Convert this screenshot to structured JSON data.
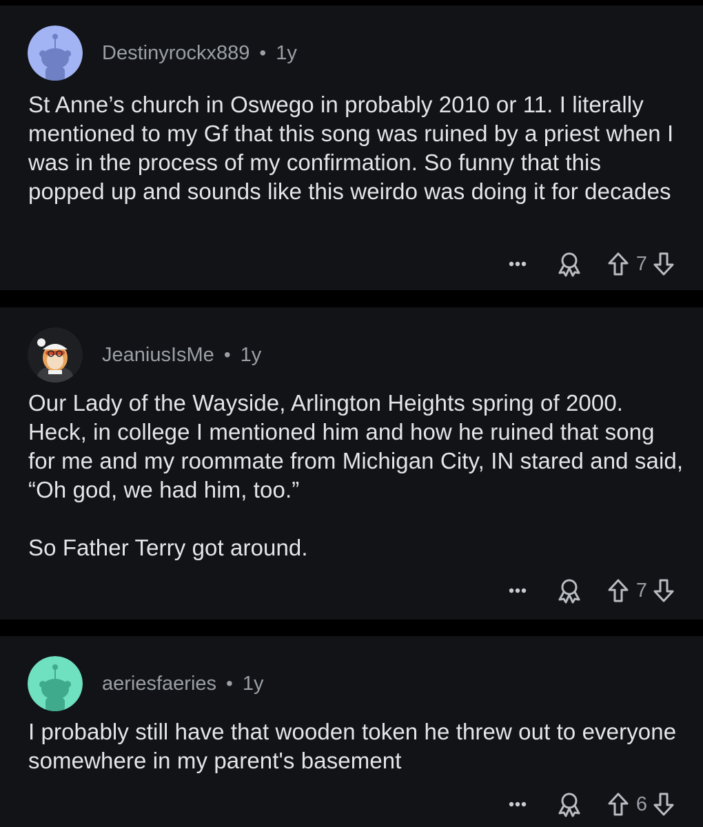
{
  "comments": [
    {
      "username": "Destinyrockx889",
      "separator": "•",
      "age": "1y",
      "avatar_color": "#a3b4f5",
      "text": "St Anne’s church in Oswego in probably 2010 or 11. I literally mentioned to my Gf that this song was ruined by a priest when I was in the process of my confirmation. So funny that this popped up and sounds like this weirdo was doing it for decades",
      "score": "7"
    },
    {
      "username": "JeaniusIsMe",
      "separator": "•",
      "age": "1y",
      "avatar_color": "#1e1f22",
      "text": "Our Lady of the Wayside, Arlington Heights spring of 2000. Heck, in college I mentioned him and how he ruined that song for me and my roommate from Michigan City, IN stared and said, “Oh god, we had him, too.”\n\nSo Father Terry got around.",
      "score": "7"
    },
    {
      "username": "aeriesfaeries",
      "separator": "•",
      "age": "1y",
      "avatar_color": "#6fe0c0",
      "text": "I probably still have that wooden token he threw out to everyone somewhere in my parent's basement",
      "score": "6"
    }
  ],
  "icons": {
    "more": "more-options-icon",
    "award": "award-icon",
    "upvote": "upvote-arrow-icon",
    "downvote": "downvote-arrow-icon"
  },
  "colors": {
    "background": "#000000",
    "card": "#121316",
    "meta_text": "#9aa0a6",
    "body_text": "#e3e5e8"
  }
}
